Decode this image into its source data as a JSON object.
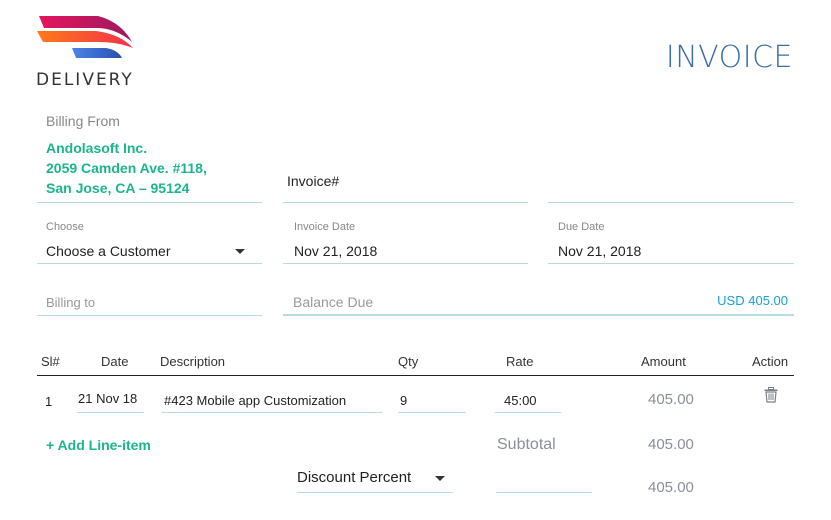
{
  "brand": {
    "name": "DELIVERY",
    "logo_colors": [
      "#e5155f",
      "#ff7a1a",
      "#3d6fd8"
    ]
  },
  "header": {
    "title": "INVOICE",
    "title_color": "#3a6ea5"
  },
  "billing_from": {
    "label": "Billing From",
    "company": "Andolasoft Inc.",
    "address_line1": "2059 Camden Ave. #118,",
    "address_line2": "San Jose, CA – 95124",
    "accent_color": "#1bb58f"
  },
  "invoice_number": {
    "label": "Invoice#",
    "value": ""
  },
  "customer": {
    "label": "Choose",
    "selected": "Choose a Customer"
  },
  "invoice_date": {
    "label": "Invoice Date",
    "value": "Nov 21, 2018"
  },
  "due_date": {
    "label": "Due Date",
    "value": "Nov 21, 2018"
  },
  "billing_to": {
    "placeholder": "Billing to"
  },
  "balance_due": {
    "label": "Balance Due",
    "value": "USD 405.00",
    "value_color": "#1a9fd8"
  },
  "table": {
    "headers": [
      "Sl#",
      "Date",
      "Description",
      "Qty",
      "Rate",
      "Amount",
      "Action"
    ],
    "rows": [
      {
        "sl": "1",
        "date": "21 Nov 18",
        "description": "#423 Mobile app Customization",
        "qty": "9",
        "rate": "45:00",
        "amount": "405.00",
        "action_icon": "trash-icon"
      }
    ]
  },
  "add_line_item": "+ Add Line-item",
  "totals": {
    "subtotal_label": "Subtotal",
    "subtotal_value": "405.00",
    "discount_type": "Discount Percent",
    "discount_value": "",
    "total_value": "405.00"
  }
}
